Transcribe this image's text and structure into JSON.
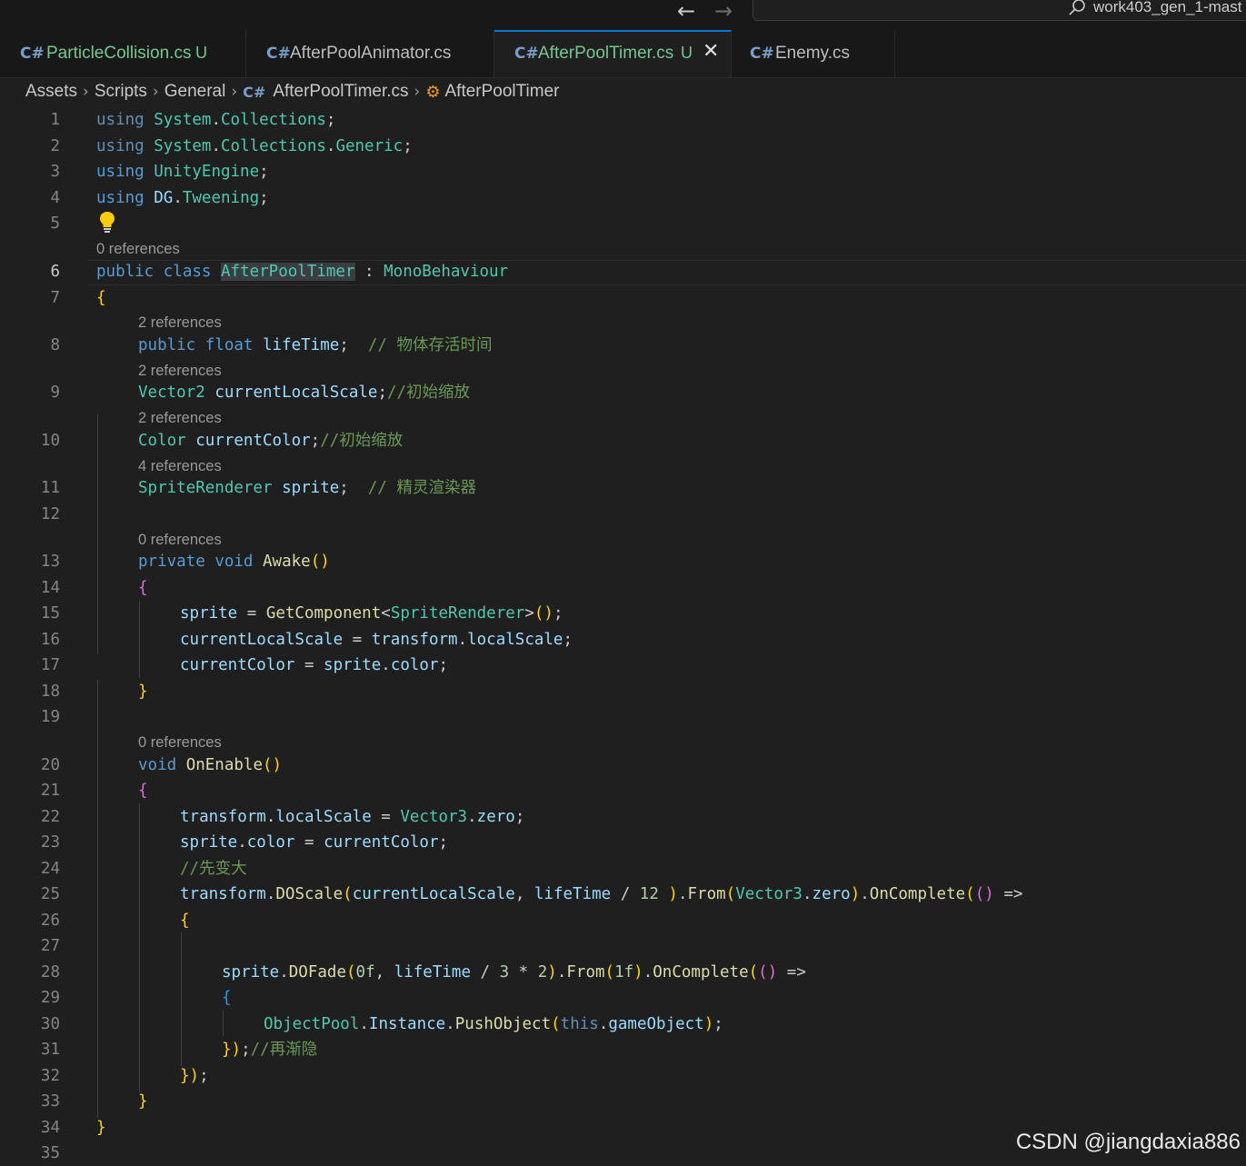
{
  "titlebar": {
    "workspace_label": "work403_gen_1-mast"
  },
  "tabs": [
    {
      "label": "ParticleCollision.cs",
      "status": "U",
      "active": false
    },
    {
      "label": "AfterPoolAnimator.cs",
      "status": "",
      "active": false
    },
    {
      "label": "AfterPoolTimer.cs",
      "status": "U",
      "active": true
    },
    {
      "label": "Enemy.cs",
      "status": "",
      "active": false
    }
  ],
  "breadcrumb": {
    "items": [
      "Assets",
      "Scripts",
      "General",
      "AfterPoolTimer.cs",
      "AfterPoolTimer"
    ]
  },
  "editor": {
    "current_line": 6,
    "line_numbers": [
      "1",
      "2",
      "3",
      "4",
      "5",
      "6",
      "7",
      "8",
      "9",
      "10",
      "11",
      "12",
      "13",
      "14",
      "15",
      "16",
      "17",
      "18",
      "19",
      "20",
      "21",
      "22",
      "23",
      "24",
      "25",
      "26",
      "27",
      "28",
      "29",
      "30",
      "31",
      "32",
      "33",
      "34",
      "35"
    ],
    "code_lens": {
      "class": "0 references",
      "lifetime": "2 references",
      "currentlocalscale": "2 references",
      "currentcolor": "2 references",
      "sprite": "4 references",
      "awake": "0 references",
      "onenable": "0 references"
    },
    "lines": {
      "l1": "using System.Collections;",
      "l2": "using System.Collections.Generic;",
      "l3": "using UnityEngine;",
      "l4": "using DG.Tweening;",
      "l6": "public class AfterPoolTimer : MonoBehaviour",
      "l7": "{",
      "l8": "public float lifeTime;  // 物体存活时间",
      "l9": "Vector2 currentLocalScale;//初始缩放",
      "l10": "Color currentColor;//初始缩放",
      "l11": "SpriteRenderer sprite;  // 精灵渲染器",
      "l13": "private void Awake()",
      "l14": "{",
      "l15": "sprite = GetComponent<SpriteRenderer>();",
      "l16": "currentLocalScale = transform.localScale;",
      "l17": "currentColor = sprite.color;",
      "l18": "}",
      "l20": "void OnEnable()",
      "l21": "{",
      "l22": "transform.localScale = Vector3.zero;",
      "l23": "sprite.color = currentColor;",
      "l24": "//先变大",
      "l25": "transform.DOScale(currentLocalScale, lifeTime / 12 ).From(Vector3.zero).OnComplete(() =>",
      "l26": "{",
      "l28": "sprite.DOFade(0f, lifeTime / 3 * 2).From(1f).OnComplete(() =>",
      "l29": "{",
      "l30": "ObjectPool.Instance.PushObject(this.gameObject);",
      "l31": "});//再渐隐",
      "l32": "});",
      "l33": "}",
      "l34": "}"
    }
  },
  "watermark": "CSDN @jiangdaxia886",
  "colors": {
    "editor_bg": "#1f1f1f",
    "keyword": "#569cd6",
    "type": "#4ec9b0",
    "function": "#dcdcaa",
    "variable": "#9cdcfe",
    "comment": "#6a9955",
    "number": "#b5cea8",
    "active_tab_accent": "#0078d4",
    "untracked": "#73c991"
  },
  "icons": {
    "tab_file_icon": "csharp-file-icon",
    "breadcrumb_class_icon": "class-symbol-icon",
    "lightbulb": "lightbulb-icon",
    "close": "close-icon",
    "search": "search-icon"
  }
}
